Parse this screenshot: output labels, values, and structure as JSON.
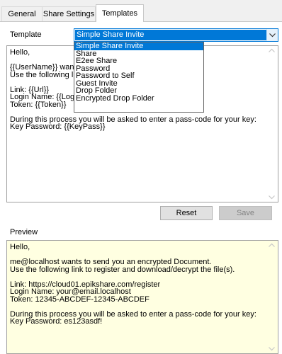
{
  "tabs": [
    {
      "label": "General"
    },
    {
      "label": "Share Settings"
    },
    {
      "label": "Templates"
    }
  ],
  "template": {
    "label": "Template",
    "selected": "Simple Share Invite",
    "options": [
      "Simple Share Invite",
      "Share",
      "E2ee Share",
      "Password",
      "Password to Self",
      "Guest Invite",
      "Drop Folder",
      "Encrypted Drop Folder"
    ]
  },
  "editor": {
    "lines": [
      "Hello,",
      "",
      "{{UserName}} want",
      "Use the following lin",
      "",
      "Link: {{Url}}",
      "Login Name: {{Logi",
      "Token: {{Token}}",
      "",
      "During this process you will be asked to enter a pass-code for your key:",
      "Key Password: {{KeyPass}}"
    ]
  },
  "buttons": {
    "reset": "Reset",
    "save": "Save"
  },
  "preview": {
    "label": "Preview",
    "lines": [
      "Hello,",
      "",
      "me@localhost wants to send you an encrypted Document.",
      "Use the following link to register and download/decrypt the file(s).",
      "",
      "Link: https://cloud01.epikshare.com/register",
      "Login Name: your@email.localhost",
      "Token: 12345-ABCDEF-12345-ABCDEF",
      "",
      "During this process you will be asked to enter a pass-code for your key:",
      "Key Password: es123asdf!"
    ]
  },
  "colors": {
    "accent": "#0078d7",
    "preview_bg": "#ffffe1",
    "tab_bg": "#f0f0f0"
  }
}
